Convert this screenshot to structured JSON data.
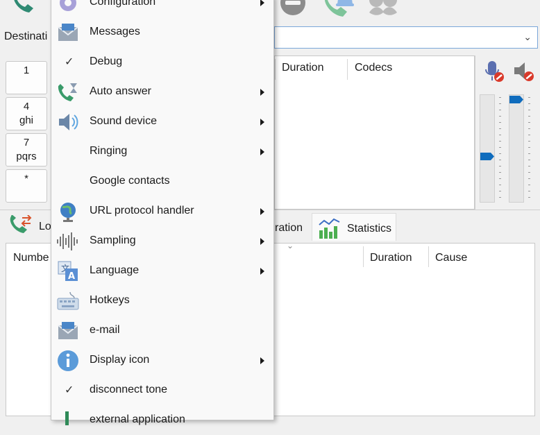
{
  "window": {
    "destination_label": "Destinati",
    "combo_chevron": "chevron-down-icon"
  },
  "dialpad": [
    {
      "digit": "1",
      "letters": ""
    },
    {
      "digit": "4",
      "letters": "ghi"
    },
    {
      "digit": "7",
      "letters": "pqrs"
    },
    {
      "digit": "*",
      "letters": ""
    }
  ],
  "calls_table": {
    "columns": [
      "Duration",
      "Codecs"
    ]
  },
  "tabs": [
    {
      "label": "Lo",
      "icon": "call-log-icon"
    },
    {
      "label": "ration",
      "icon": ""
    },
    {
      "label": "Statistics",
      "icon": "statistics-chart-icon"
    }
  ],
  "log_table": {
    "columns": [
      "Numbe",
      "Duration",
      "Cause"
    ]
  },
  "menu": {
    "items": [
      {
        "label": "Configuration",
        "icon": "gear-icon",
        "checked": false,
        "submenu": true
      },
      {
        "label": "Messages",
        "icon": "envelope-icon",
        "checked": false,
        "submenu": false
      },
      {
        "label": "Debug",
        "icon": "",
        "checked": true,
        "submenu": false
      },
      {
        "label": "Auto answer",
        "icon": "phone-hourglass-icon",
        "checked": false,
        "submenu": true
      },
      {
        "label": "Sound device",
        "icon": "speaker-icon",
        "checked": false,
        "submenu": true
      },
      {
        "label": "Ringing",
        "icon": "",
        "checked": false,
        "submenu": true
      },
      {
        "label": "Google contacts",
        "icon": "",
        "checked": false,
        "submenu": false
      },
      {
        "label": "URL protocol handler",
        "icon": "globe-icon",
        "checked": false,
        "submenu": true
      },
      {
        "label": "Sampling",
        "icon": "waveform-icon",
        "checked": false,
        "submenu": true
      },
      {
        "label": "Language",
        "icon": "language-icon",
        "checked": false,
        "submenu": true
      },
      {
        "label": "Hotkeys",
        "icon": "keyboard-icon",
        "checked": false,
        "submenu": false
      },
      {
        "label": "e-mail",
        "icon": "envelope-icon",
        "checked": false,
        "submenu": false
      },
      {
        "label": "Display icon",
        "icon": "info-icon",
        "checked": false,
        "submenu": true
      },
      {
        "label": "disconnect tone",
        "icon": "",
        "checked": true,
        "submenu": false
      },
      {
        "label": "external application",
        "icon": "phone-icon",
        "checked": false,
        "submenu": false
      }
    ]
  },
  "colors": {
    "accent": "#0f6cbd",
    "phone_green": "#3a9b6a",
    "menu_bg": "#f9f9f9"
  }
}
